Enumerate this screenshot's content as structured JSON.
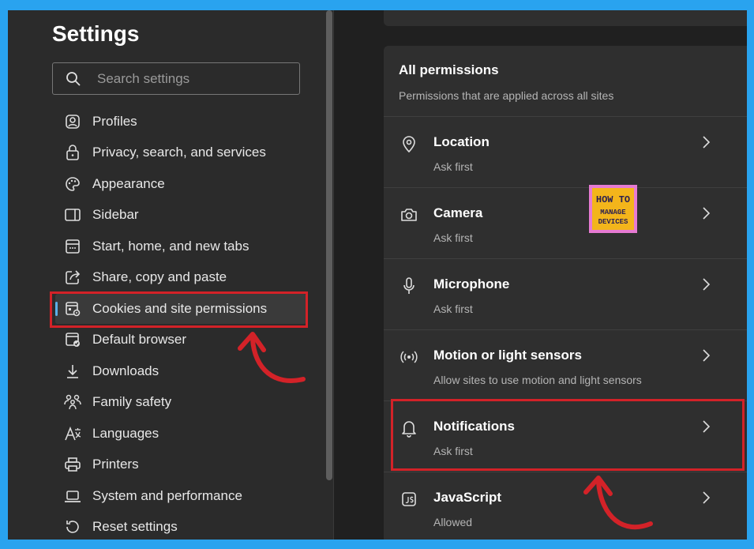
{
  "settings": {
    "title": "Settings",
    "search_placeholder": "Search settings",
    "search_value": "",
    "nav": [
      {
        "label": "Profiles",
        "icon": "profile-icon"
      },
      {
        "label": "Privacy, search, and services",
        "icon": "lock-icon"
      },
      {
        "label": "Appearance",
        "icon": "palette-icon"
      },
      {
        "label": "Sidebar",
        "icon": "sidebar-icon"
      },
      {
        "label": "Start, home, and new tabs",
        "icon": "home-tabs-icon"
      },
      {
        "label": "Share, copy and paste",
        "icon": "share-icon"
      },
      {
        "label": "Cookies and site permissions",
        "icon": "cookies-permissions-icon",
        "active": true
      },
      {
        "label": "Default browser",
        "icon": "default-browser-icon"
      },
      {
        "label": "Downloads",
        "icon": "download-icon"
      },
      {
        "label": "Family safety",
        "icon": "family-icon"
      },
      {
        "label": "Languages",
        "icon": "languages-icon"
      },
      {
        "label": "Printers",
        "icon": "printer-icon"
      },
      {
        "label": "System and performance",
        "icon": "laptop-icon"
      },
      {
        "label": "Reset settings",
        "icon": "reset-icon"
      }
    ]
  },
  "permissions": {
    "heading": "All permissions",
    "subheading": "Permissions that are applied across all sites",
    "items": [
      {
        "title": "Location",
        "subtitle": "Ask first",
        "icon": "location-pin-icon"
      },
      {
        "title": "Camera",
        "subtitle": "Ask first",
        "icon": "camera-icon"
      },
      {
        "title": "Microphone",
        "subtitle": "Ask first",
        "icon": "microphone-icon"
      },
      {
        "title": "Motion or light sensors",
        "subtitle": "Allow sites to use motion and light sensors",
        "icon": "sensor-icon"
      },
      {
        "title": "Notifications",
        "subtitle": "Ask first",
        "icon": "bell-icon"
      },
      {
        "title": "JavaScript",
        "subtitle": "Allowed",
        "icon": "javascript-icon"
      }
    ]
  },
  "watermark": {
    "line1": "HOW TO",
    "line2": "MANAGE",
    "line3": "DEVICES"
  },
  "colors": {
    "accent": "#5cb0e8",
    "highlight": "#d32228",
    "frame": "#29a3ef",
    "background": "#2b2b2b",
    "card": "#2f2f2f"
  }
}
